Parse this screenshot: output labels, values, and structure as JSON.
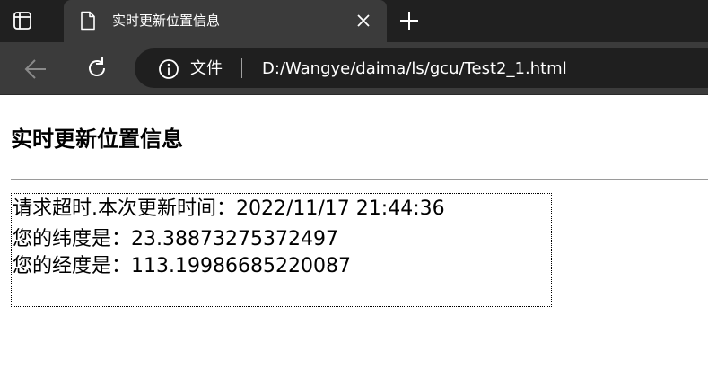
{
  "tab": {
    "title": "实时更新位置信息"
  },
  "toolbar": {
    "site_label": "文件",
    "url": "D:/Wangye/daima/ls/gcu/Test2_1.html"
  },
  "icons": {
    "tab_actions": "tab-actions-icon",
    "favicon": "page-icon",
    "close": "close-icon",
    "new_tab": "plus-icon",
    "back": "arrow-left-icon",
    "refresh": "refresh-icon",
    "site_info": "info-icon"
  },
  "page": {
    "heading": "实时更新位置信息",
    "status": "请求超时.本次更新时间：2022/11/17 21:44:36",
    "latitude": "您的纬度是：23.38873275372497",
    "longitude": "您的经度是：113.19986685220087"
  },
  "colors": {
    "tabstrip_bg": "#202020",
    "active_tab_bg": "#3b3b3b",
    "addressbar_bg": "#1f1f1f",
    "page_bg": "#ffffff"
  }
}
